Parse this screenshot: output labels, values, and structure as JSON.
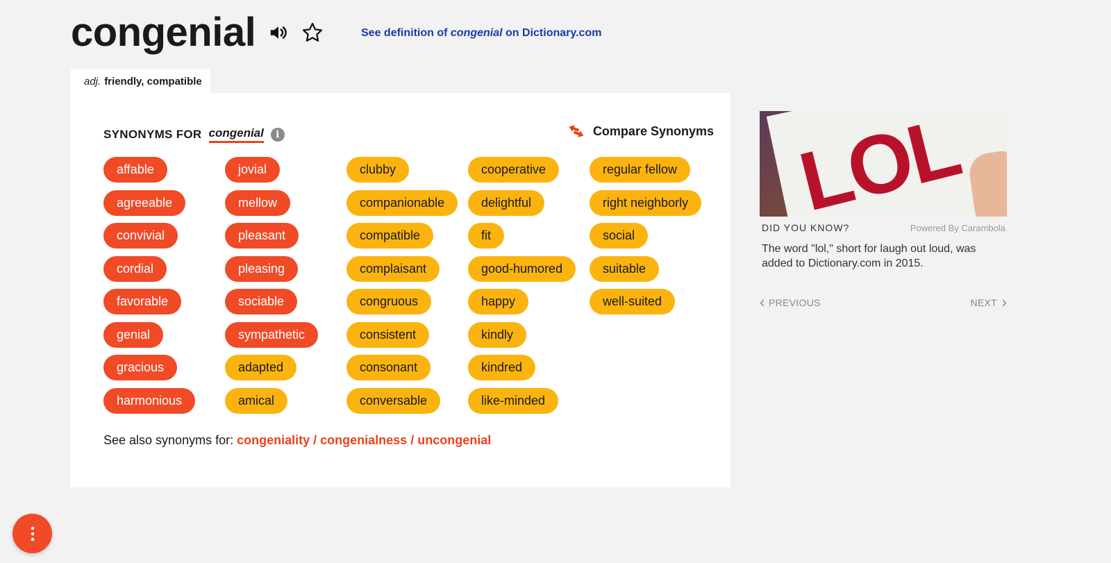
{
  "header": {
    "word": "congenial",
    "definition_link": {
      "prefix": "See definition of ",
      "word": "congenial",
      "suffix": " on Dictionary.com"
    }
  },
  "pos_tab": {
    "pos": "adj.",
    "gloss": "friendly, compatible"
  },
  "synonyms": {
    "heading": "SYNONYMS FOR",
    "word": "congenial",
    "info_glyph": "i",
    "compare_label": "Compare Synonyms",
    "columns": [
      [
        {
          "text": "affable",
          "strength": "strong"
        },
        {
          "text": "agreeable",
          "strength": "strong"
        },
        {
          "text": "convivial",
          "strength": "strong"
        },
        {
          "text": "cordial",
          "strength": "strong"
        },
        {
          "text": "favorable",
          "strength": "strong"
        },
        {
          "text": "genial",
          "strength": "strong"
        },
        {
          "text": "gracious",
          "strength": "strong"
        },
        {
          "text": "harmonious",
          "strength": "strong"
        }
      ],
      [
        {
          "text": "jovial",
          "strength": "strong"
        },
        {
          "text": "mellow",
          "strength": "strong"
        },
        {
          "text": "pleasant",
          "strength": "strong"
        },
        {
          "text": "pleasing",
          "strength": "strong"
        },
        {
          "text": "sociable",
          "strength": "strong"
        },
        {
          "text": "sympathetic",
          "strength": "strong"
        },
        {
          "text": "adapted",
          "strength": "mid"
        },
        {
          "text": "amical",
          "strength": "mid"
        }
      ],
      [
        {
          "text": "clubby",
          "strength": "mid"
        },
        {
          "text": "companionable",
          "strength": "mid"
        },
        {
          "text": "compatible",
          "strength": "mid"
        },
        {
          "text": "complaisant",
          "strength": "mid"
        },
        {
          "text": "congruous",
          "strength": "mid"
        },
        {
          "text": "consistent",
          "strength": "mid"
        },
        {
          "text": "consonant",
          "strength": "mid"
        },
        {
          "text": "conversable",
          "strength": "mid"
        }
      ],
      [
        {
          "text": "cooperative",
          "strength": "mid"
        },
        {
          "text": "delightful",
          "strength": "mid"
        },
        {
          "text": "fit",
          "strength": "mid"
        },
        {
          "text": "good-humored",
          "strength": "mid"
        },
        {
          "text": "happy",
          "strength": "mid"
        },
        {
          "text": "kindly",
          "strength": "mid"
        },
        {
          "text": "kindred",
          "strength": "mid"
        },
        {
          "text": "like-minded",
          "strength": "mid"
        }
      ],
      [
        {
          "text": "regular fellow",
          "strength": "mid"
        },
        {
          "text": "right neighborly",
          "strength": "mid"
        },
        {
          "text": "social",
          "strength": "mid"
        },
        {
          "text": "suitable",
          "strength": "mid"
        },
        {
          "text": "well-suited",
          "strength": "mid"
        }
      ]
    ],
    "see_also": {
      "label": "See also synonyms for: ",
      "links": [
        "congeniality",
        "congenialness",
        "uncongenial"
      ],
      "separator": " / "
    }
  },
  "did_you_know": {
    "image_text": "LOL",
    "title": "DID YOU KNOW?",
    "powered_by": "Powered By Carambola",
    "fact": "The word \"lol,\" short for laugh out loud, was added to Dictionary.com in 2015.",
    "previous_label": "PREVIOUS",
    "next_label": "NEXT"
  },
  "icons": {
    "speaker": "speaker-icon",
    "star": "star-outline-icon",
    "compare": "compare-arrows-icon",
    "menu": "vertical-dots-icon"
  },
  "colors": {
    "strong_chip": "#f04a26",
    "mid_chip": "#fbb40f",
    "link_blue": "#1a3aa8",
    "accent_red": "#e8431f"
  }
}
